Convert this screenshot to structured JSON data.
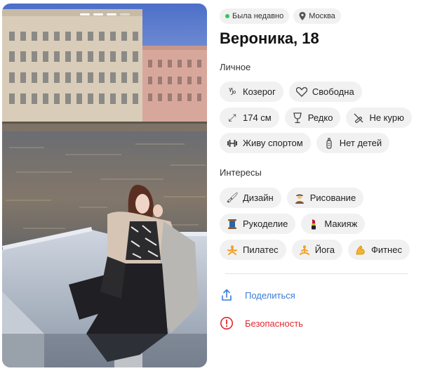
{
  "status": {
    "online_label": "Была недавно",
    "city": "Москва"
  },
  "profile": {
    "name_age": "Вероника, 18"
  },
  "photo": {
    "count": 4,
    "current": 3
  },
  "personal": {
    "title": "Личное",
    "items": [
      {
        "icon": "capricorn-icon",
        "label": "Козерог"
      },
      {
        "icon": "heart-icon",
        "label": "Свободна"
      },
      {
        "icon": "height-icon",
        "label": "174 см"
      },
      {
        "icon": "wine-glass-icon",
        "label": "Редко"
      },
      {
        "icon": "no-smoking-icon",
        "label": "Не курю"
      },
      {
        "icon": "dumbbell-icon",
        "label": "Живу спортом"
      },
      {
        "icon": "baby-bottle-icon",
        "label": "Нет детей"
      }
    ]
  },
  "interests": {
    "title": "Интересы",
    "items": [
      {
        "icon": "paintbrush-icon",
        "label": "Дизайн"
      },
      {
        "icon": "artist-icon",
        "label": "Рисование"
      },
      {
        "icon": "thread-icon",
        "label": "Рукоделие"
      },
      {
        "icon": "lipstick-icon",
        "label": "Макияж"
      },
      {
        "icon": "pilates-icon",
        "label": "Пилатес"
      },
      {
        "icon": "yoga-icon",
        "label": "Йога"
      },
      {
        "icon": "flexed-biceps-icon",
        "label": "Фитнес"
      }
    ]
  },
  "actions": {
    "share_label": "Поделиться",
    "safety_label": "Безопасность"
  },
  "colors": {
    "accent": "#3b7dd8",
    "danger": "#e0282e",
    "chip_bg": "#f1f1f1",
    "online": "#34c759"
  }
}
